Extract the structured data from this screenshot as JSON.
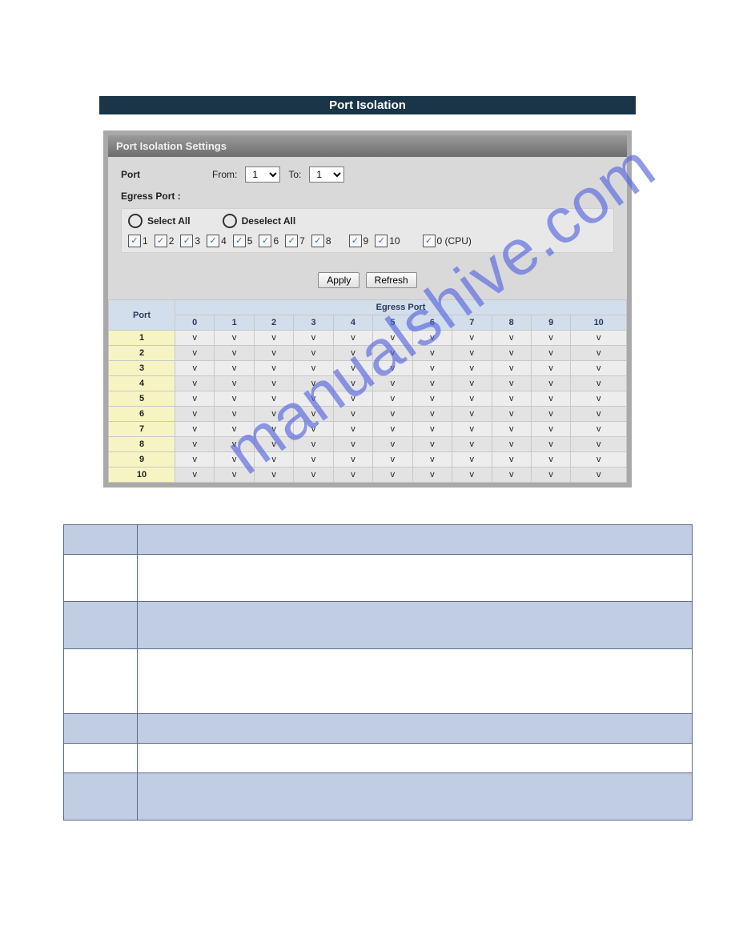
{
  "title_bar": "Port Isolation",
  "panel_header": "Port Isolation Settings",
  "port_label": "Port",
  "from_label": "From:",
  "to_label": "To:",
  "from_value": "1",
  "to_value": "1",
  "egress_port_label": "Egress Port :",
  "select_all": "Select All",
  "deselect_all": "Deselect All",
  "checks": [
    "1",
    "2",
    "3",
    "4",
    "5",
    "6",
    "7",
    "8",
    "9",
    "10",
    "0 (CPU)"
  ],
  "apply_btn": "Apply",
  "refresh_btn": "Refresh",
  "super_header": "Egress Port",
  "col_port": "Port",
  "cols": [
    "0",
    "1",
    "2",
    "3",
    "4",
    "5",
    "6",
    "7",
    "8",
    "9",
    "10"
  ],
  "rows": [
    "1",
    "2",
    "3",
    "4",
    "5",
    "6",
    "7",
    "8",
    "9",
    "10"
  ],
  "cell_value": "v",
  "watermark": "manualshive.com"
}
